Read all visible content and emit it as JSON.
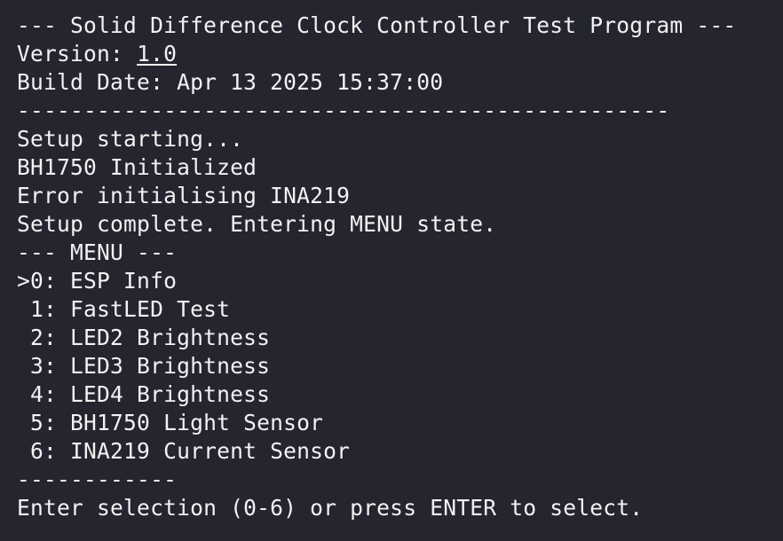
{
  "terminal": {
    "title_line": "--- Solid Difference Clock Controller Test Program ---",
    "version_label": "Version: ",
    "version_value": "1.0",
    "build_date_line": "Build Date: Apr 13 2025 15:37:00",
    "separator_long": "-------------------------------------------------",
    "setup_lines": [
      "Setup starting...",
      "BH1750 Initialized",
      "Error initialising INA219",
      "Setup complete. Entering MENU state."
    ],
    "menu_header": "--- MENU ---",
    "menu_items": [
      ">0: ESP Info",
      " 1: FastLED Test",
      " 2: LED2 Brightness",
      " 3: LED3 Brightness",
      " 4: LED4 Brightness",
      " 5: BH1750 Light Sensor",
      " 6: INA219 Current Sensor"
    ],
    "separator_short": "------------",
    "prompt": "Enter selection (0-6) or press ENTER to select."
  },
  "colors": {
    "background": "#24252f",
    "text": "#f2f2f2"
  }
}
